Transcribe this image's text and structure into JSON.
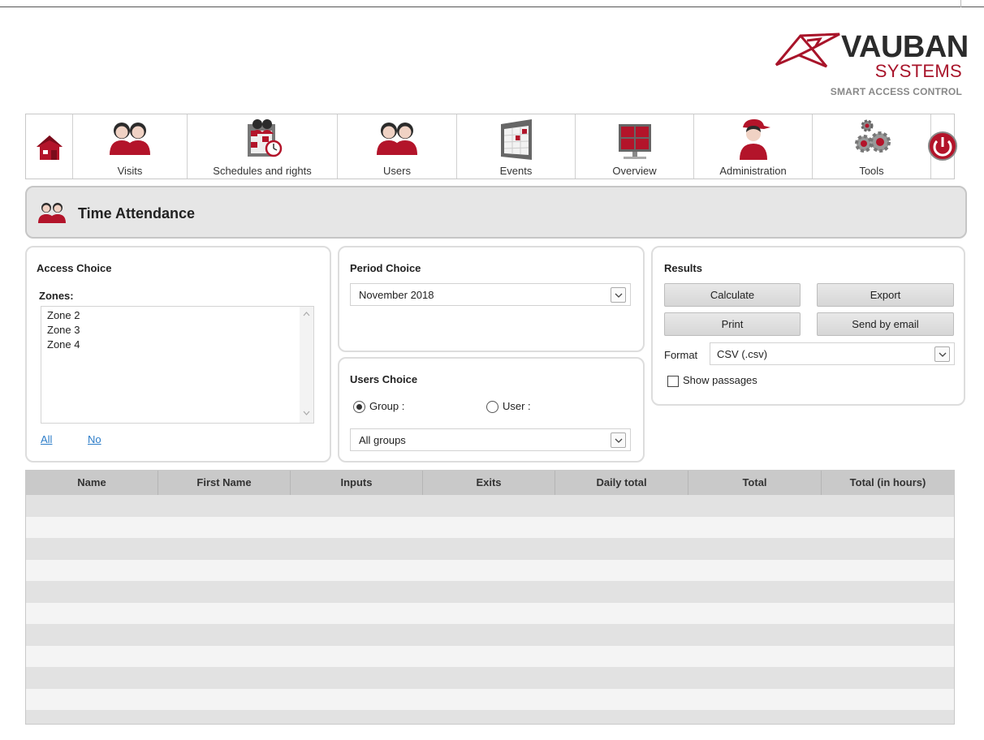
{
  "brand": {
    "name": "VAUBAN",
    "subtitle": "SYSTEMS",
    "tagline": "SMART ACCESS CONTROL",
    "accent": "#a8142a"
  },
  "nav": {
    "items": [
      {
        "label": "",
        "icon": "home-icon"
      },
      {
        "label": "Visits",
        "icon": "visitors-icon"
      },
      {
        "label": "Schedules and rights",
        "icon": "schedule-icon"
      },
      {
        "label": "Users",
        "icon": "users-icon"
      },
      {
        "label": "Events",
        "icon": "calendar-icon"
      },
      {
        "label": "Overview",
        "icon": "monitor-icon"
      },
      {
        "label": "Administration",
        "icon": "admin-icon"
      },
      {
        "label": "Tools",
        "icon": "gears-icon"
      },
      {
        "label": "",
        "icon": "power-icon"
      }
    ]
  },
  "page": {
    "title": "Time Attendance"
  },
  "access": {
    "title": "Access Choice",
    "zones_label": "Zones:",
    "zones": [
      "Zone 2",
      "Zone 3",
      "Zone 4"
    ],
    "all_link": "All",
    "none_link": "No"
  },
  "period": {
    "title": "Period Choice",
    "selected": "November 2018"
  },
  "users": {
    "title": "Users Choice",
    "group_label": "Group :",
    "user_label": "User :",
    "mode": "group",
    "group_selected": "All groups"
  },
  "results": {
    "title": "Results",
    "calculate": "Calculate",
    "export": "Export",
    "print": "Print",
    "send": "Send by email",
    "format_label": "Format",
    "format_selected": "CSV (.csv)",
    "show_passages": "Show passages",
    "show_passages_checked": false
  },
  "table": {
    "columns": [
      "Name",
      "First Name",
      "Inputs",
      "Exits",
      "Daily total",
      "Total",
      "Total (in hours)"
    ],
    "rows": []
  }
}
